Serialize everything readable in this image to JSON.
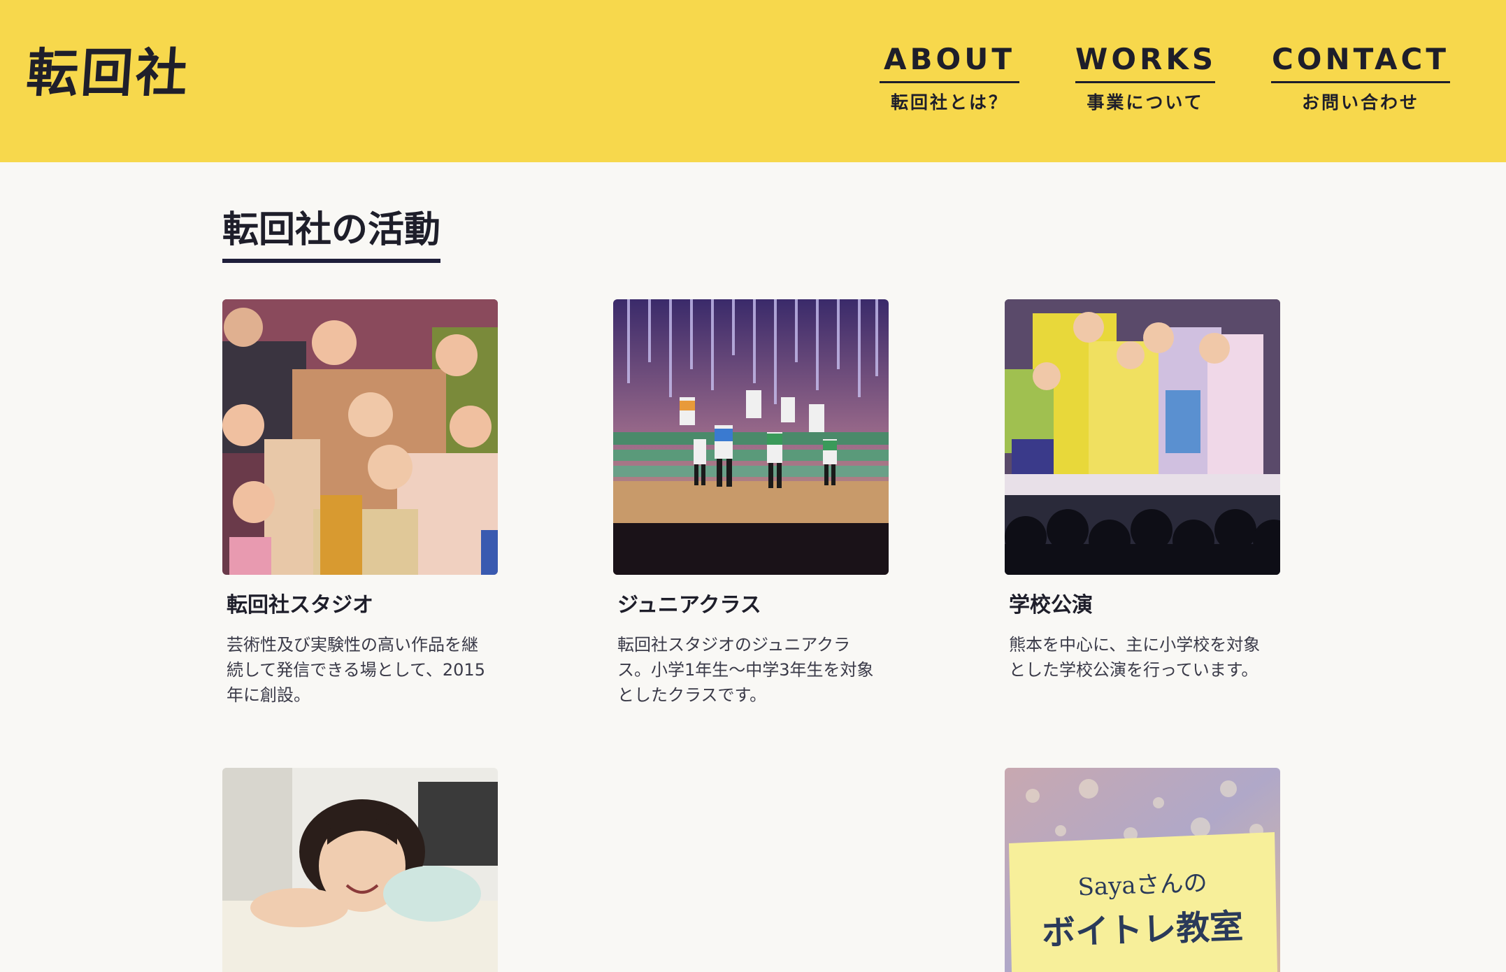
{
  "header": {
    "logo": "転回社",
    "nav": [
      {
        "en": "ABOUT",
        "ja": "転回社とは？"
      },
      {
        "en": "WORKS",
        "ja": "事業について"
      },
      {
        "en": "CONTACT",
        "ja": "お問い合わせ"
      }
    ],
    "colors": {
      "header_bg": "#f7d84c",
      "text": "#1e1e2a"
    }
  },
  "main": {
    "section_title": "転回社の活動",
    "cards": [
      {
        "title": "転回社スタジオ",
        "text": "芸術性及び実験性の高い作品を継続して発信できる場として、2015年に創設。",
        "image": "costumed-cast-group-photo"
      },
      {
        "title": "ジュニアクラス",
        "text": "転回社スタジオのジュニアクラス。小学1年生〜中学3年生を対象としたクラスです。",
        "image": "stage-dance-performance-photo"
      },
      {
        "title": "学校公演",
        "text": "熊本を中心に、主に小学校を対象とした学校公演を行っています。",
        "image": "school-performance-photo"
      },
      {
        "title": "",
        "text": "",
        "image": "portrait-photo"
      },
      {
        "title": "",
        "text": "",
        "image": "voice-training-banner",
        "banner_line1": "Sayaさんの",
        "banner_line2": "ボイトレ教室"
      }
    ]
  }
}
